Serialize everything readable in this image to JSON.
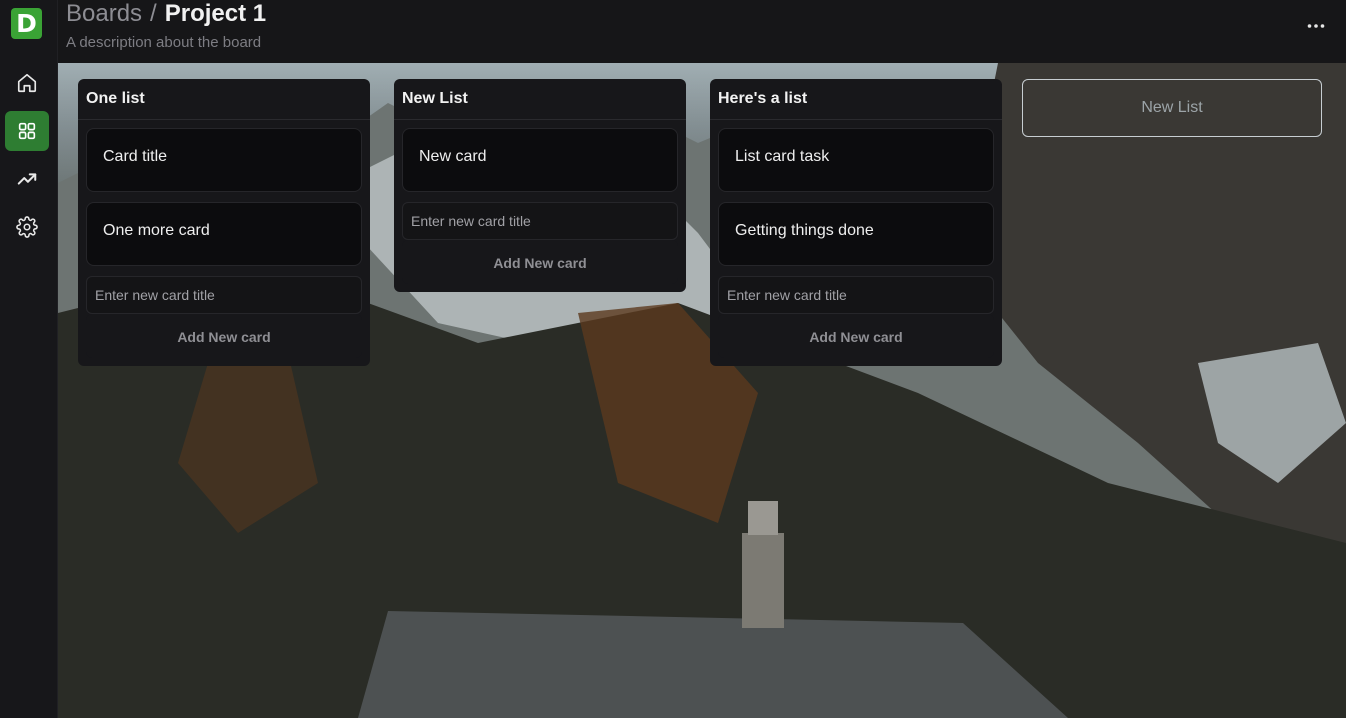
{
  "app": {
    "logo_letter": "D",
    "brand_color": "#3aa335"
  },
  "sidebar": {
    "items": [
      {
        "name": "home",
        "icon": "home-icon",
        "active": false
      },
      {
        "name": "boards",
        "icon": "grid-icon",
        "active": true
      },
      {
        "name": "analytics",
        "icon": "trending-up-icon",
        "active": false
      },
      {
        "name": "settings",
        "icon": "gear-icon",
        "active": false
      }
    ],
    "active_color": "#2e7d32"
  },
  "header": {
    "breadcrumb_parent": "Boards",
    "breadcrumb_separator": "/",
    "title": "Project 1",
    "description": "A description about the board",
    "more_icon": "more-horizontal-icon"
  },
  "lists": [
    {
      "title": "One list",
      "cards": [
        "Card title",
        "One more card"
      ],
      "input_placeholder": "Enter new card title",
      "add_label": "Add New card"
    },
    {
      "title": "New List",
      "cards": [
        "New card"
      ],
      "input_placeholder": "Enter new card title",
      "add_label": "Add New card"
    },
    {
      "title": "Here's a list",
      "cards": [
        "List card task",
        "Getting things done"
      ],
      "input_placeholder": "Enter new card title",
      "add_label": "Add New card"
    }
  ],
  "new_list_label": "New List"
}
